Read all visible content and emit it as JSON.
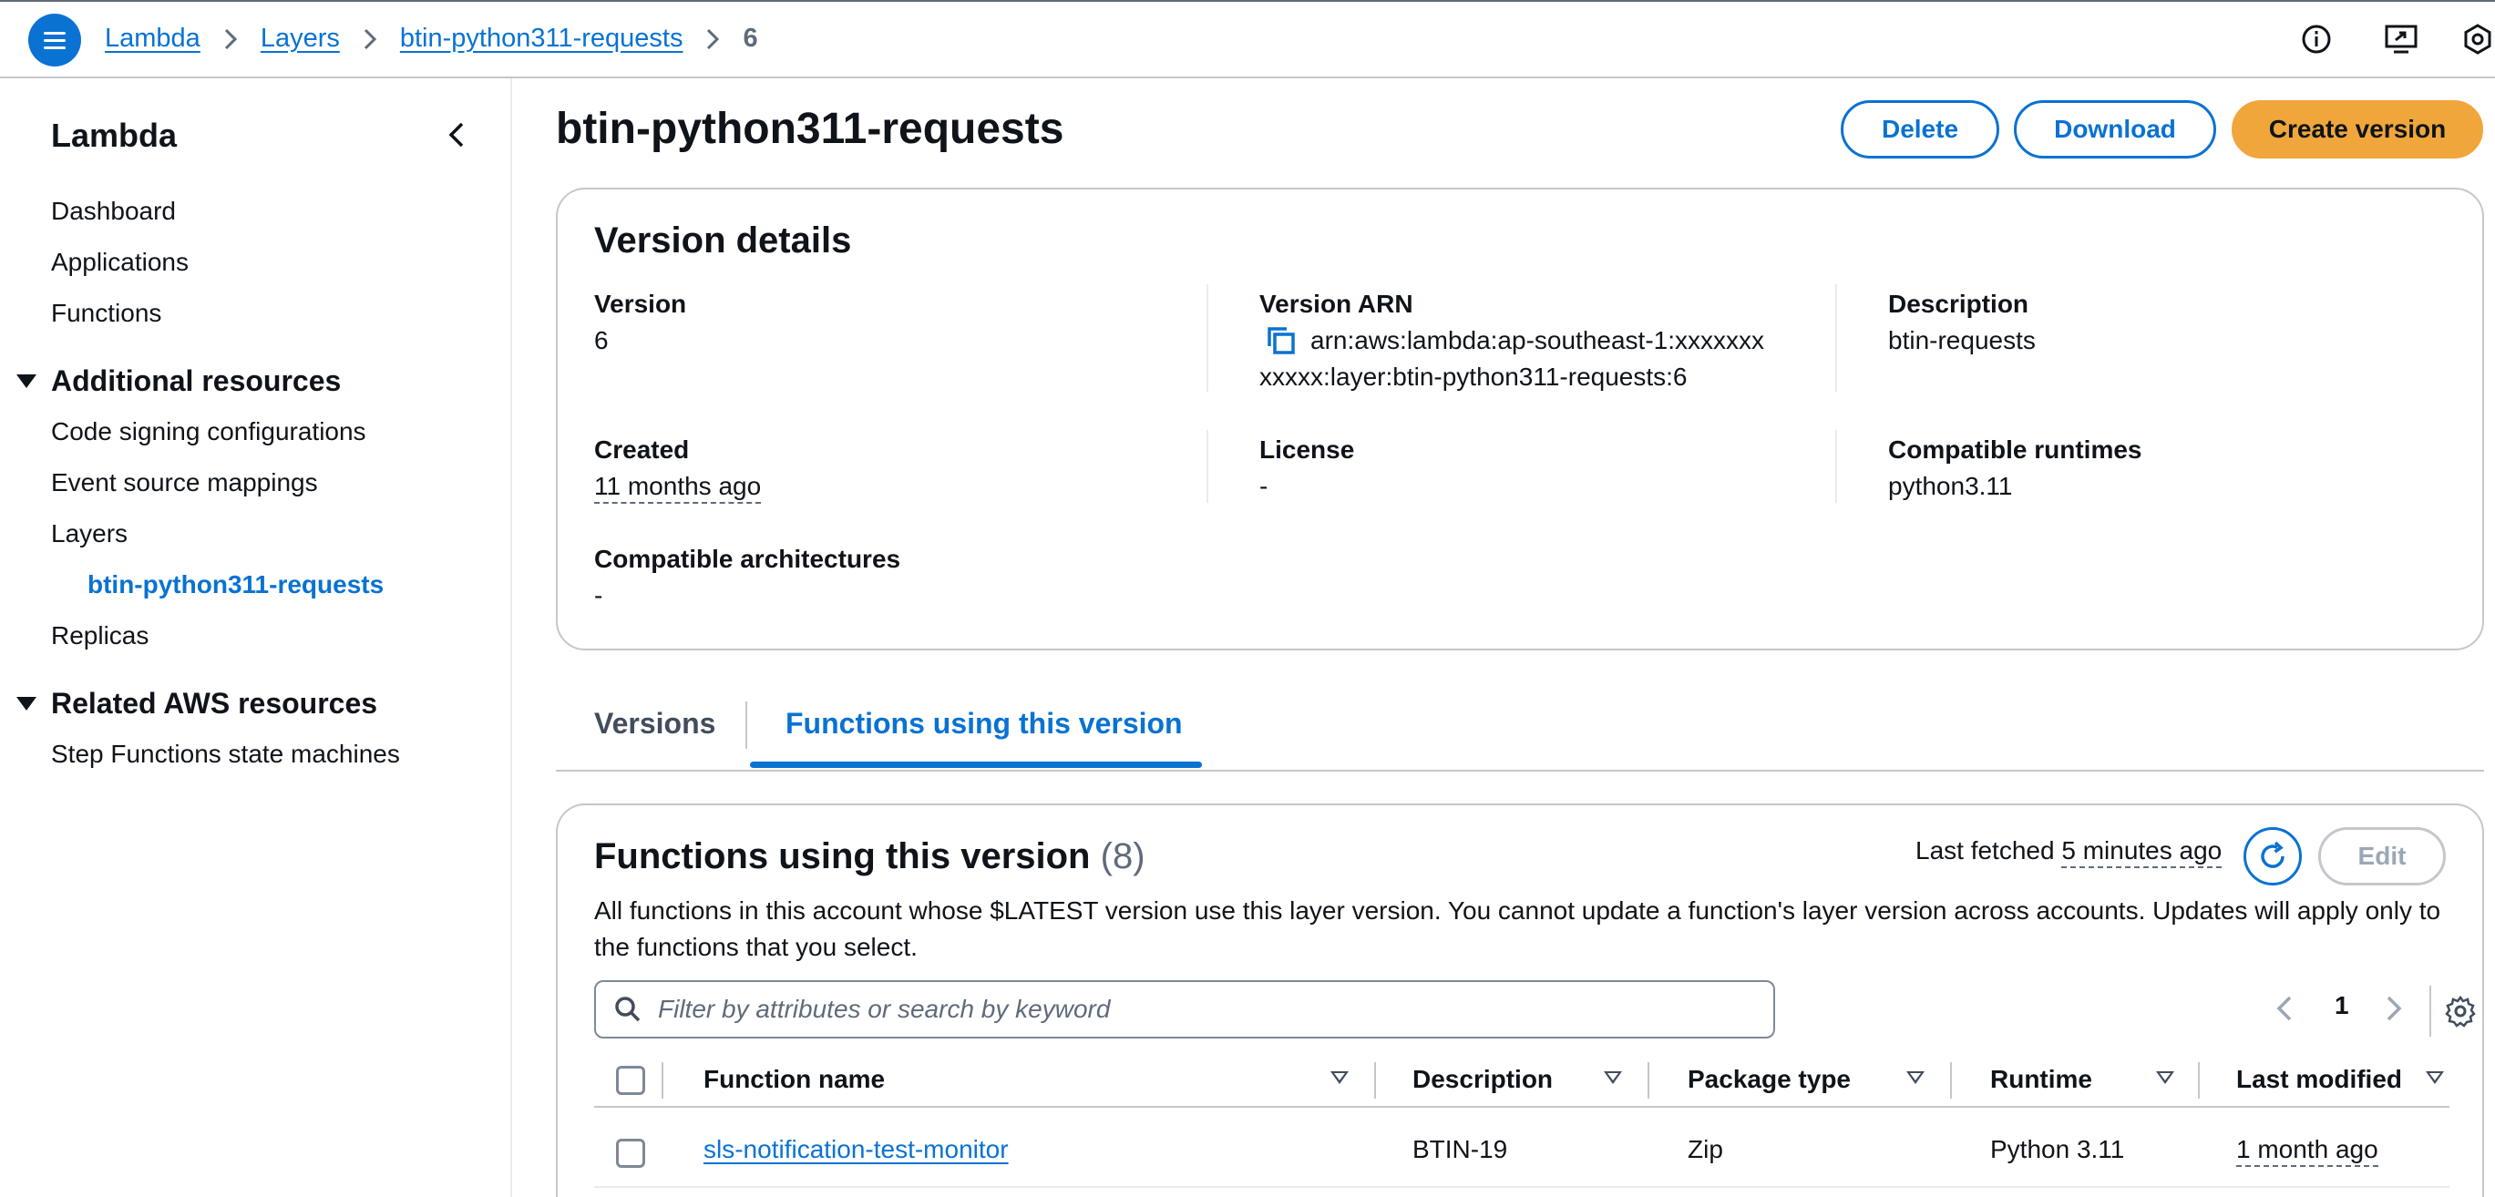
{
  "breadcrumbs": [
    "Lambda",
    "Layers",
    "btin-python311-requests",
    "6"
  ],
  "sidebar": {
    "title": "Lambda",
    "items": [
      "Dashboard",
      "Applications",
      "Functions"
    ],
    "additional_resources": {
      "label": "Additional resources",
      "items": [
        "Code signing configurations",
        "Event source mappings",
        "Layers"
      ],
      "active_sub": "btin-python311-requests",
      "after": "Replicas"
    },
    "related": {
      "label": "Related AWS resources",
      "items": [
        "Step Functions state machines"
      ]
    }
  },
  "header": {
    "title": "btin-python311-requests",
    "delete_label": "Delete",
    "download_label": "Download",
    "create_label": "Create version"
  },
  "version_details": {
    "title": "Version details",
    "version_label": "Version",
    "version_value": "6",
    "arn_label": "Version ARN",
    "arn_line1": "arn:aws:lambda:ap-southeast-1:xxxxxxx",
    "arn_line2": "xxxxx:layer:btin-python311-requests:6",
    "description_label": "Description",
    "description_value": "btin-requests",
    "created_label": "Created",
    "created_value": "11 months ago",
    "license_label": "License",
    "license_value": "-",
    "runtimes_label": "Compatible runtimes",
    "runtimes_value": "python3.11",
    "arch_label": "Compatible architectures",
    "arch_value": "-"
  },
  "tabs": [
    {
      "label": "Versions",
      "active": false
    },
    {
      "label": "Functions using this version",
      "active": true
    }
  ],
  "functions_panel": {
    "title": "Functions using this version",
    "count": "(8)",
    "last_fetched_label": "Last fetched",
    "last_fetched_value": "5 minutes ago",
    "edit_label": "Edit",
    "description": "All functions in this account whose $LATEST version use this layer version. You cannot update a function's layer version across accounts. Updates will apply only to the functions that you select.",
    "search_placeholder": "Filter by attributes or search by keyword",
    "page_number": "1",
    "columns": [
      "Function name",
      "Description",
      "Package type",
      "Runtime",
      "Last modified"
    ],
    "rows": [
      {
        "name": "sls-notification-test-monitor",
        "description": "BTIN-19",
        "package_type": "Zip",
        "runtime": "Python 3.11",
        "last_modified": "1 month ago"
      }
    ]
  },
  "colors": {
    "accent": "#0972d3",
    "primary_button": "#f0a63a",
    "text": "#0f141a",
    "muted": "#5f6b7a"
  }
}
